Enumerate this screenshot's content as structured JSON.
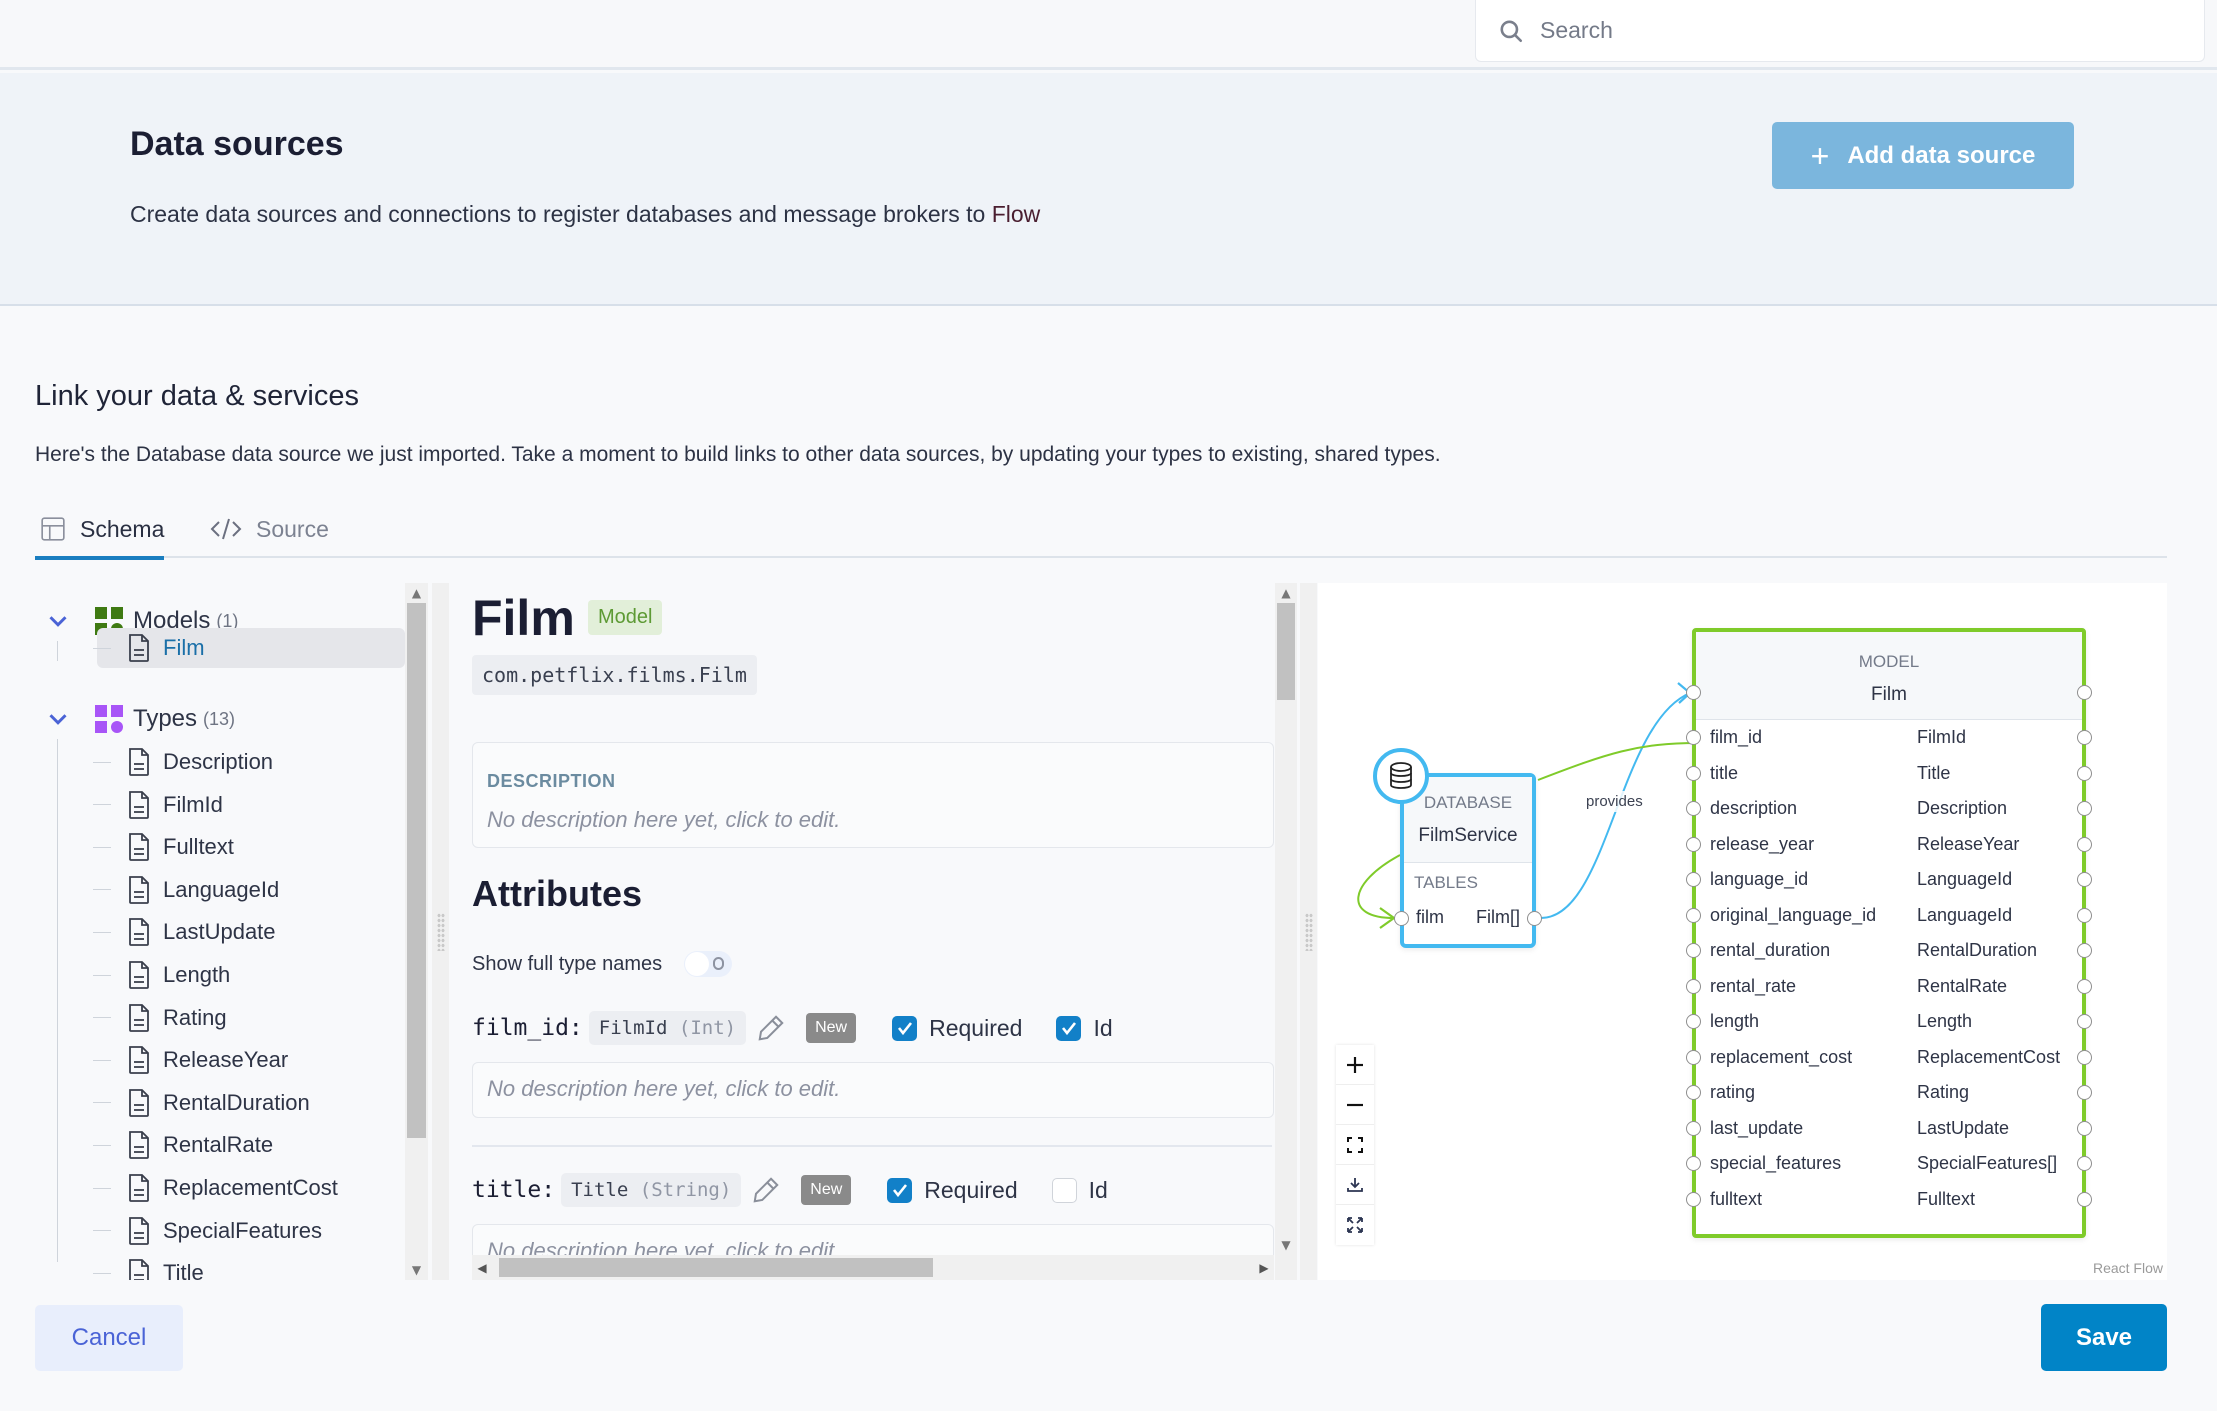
{
  "search": {
    "placeholder": "Search"
  },
  "header": {
    "title": "Data sources",
    "subtitle_prefix": "Create data sources and connections to register databases and message brokers to ",
    "subtitle_brand": "Flow",
    "add_button_label": "Add data source"
  },
  "section": {
    "title": "Link your data & services",
    "description": "Here's the Database data source we just imported. Take a moment to build links to other data sources, by updating your types to existing, shared types."
  },
  "tabs": [
    {
      "label": "Schema",
      "icon": "table-icon",
      "active": true
    },
    {
      "label": "Source",
      "icon": "code-icon",
      "active": false
    }
  ],
  "tree": {
    "models": {
      "label": "Models",
      "count": "(1)",
      "color": "#3f7a12",
      "items": [
        "Film"
      ]
    },
    "types": {
      "label": "Types",
      "count": "(13)",
      "color": "#a855f7",
      "items": [
        "Description",
        "FilmId",
        "Fulltext",
        "LanguageId",
        "LastUpdate",
        "Length",
        "Rating",
        "ReleaseYear",
        "RentalDuration",
        "RentalRate",
        "ReplacementCost",
        "SpecialFeatures",
        "Title"
      ]
    },
    "selected": "Film"
  },
  "detail": {
    "name": "Film",
    "badge": "Model",
    "fqn": "com.petflix.films.Film",
    "description_label": "DESCRIPTION",
    "description_placeholder": "No description here yet, click to edit.",
    "attributes_title": "Attributes",
    "show_full_type_names_label": "Show full type names",
    "show_full_type_names": false,
    "attributes": [
      {
        "name": "film_id:",
        "type": "FilmId",
        "primitive": "(Int)",
        "badge": "New",
        "required_label": "Required",
        "required": true,
        "id_label": "Id",
        "id": true,
        "description": "No description here yet, click to edit."
      },
      {
        "name": "title:",
        "type": "Title",
        "primitive": "(String)",
        "badge": "New",
        "required_label": "Required",
        "required": true,
        "id_label": "Id",
        "id": false,
        "description": "No description here yet, click to edit."
      }
    ]
  },
  "diagram": {
    "database_node": {
      "kind": "DATABASE",
      "name": "FilmService",
      "section": "TABLES",
      "table": "film",
      "table_type": "Film[]"
    },
    "edge_label": "provides",
    "model_node": {
      "kind": "MODEL",
      "name": "Film",
      "fields": [
        {
          "name": "film_id",
          "type": "FilmId"
        },
        {
          "name": "title",
          "type": "Title"
        },
        {
          "name": "description",
          "type": "Description"
        },
        {
          "name": "release_year",
          "type": "ReleaseYear"
        },
        {
          "name": "language_id",
          "type": "LanguageId"
        },
        {
          "name": "original_language_id",
          "type": "LanguageId"
        },
        {
          "name": "rental_duration",
          "type": "RentalDuration"
        },
        {
          "name": "rental_rate",
          "type": "RentalRate"
        },
        {
          "name": "length",
          "type": "Length"
        },
        {
          "name": "replacement_cost",
          "type": "ReplacementCost"
        },
        {
          "name": "rating",
          "type": "Rating"
        },
        {
          "name": "last_update",
          "type": "LastUpdate"
        },
        {
          "name": "special_features",
          "type": "SpecialFeatures[]"
        },
        {
          "name": "fulltext",
          "type": "Fulltext"
        }
      ]
    },
    "controls": [
      "zoom-in",
      "zoom-out",
      "fit-view",
      "download",
      "fullscreen"
    ],
    "attribution": "React Flow",
    "colors": {
      "database": "#43b9f0",
      "model": "#7fcb2a"
    }
  },
  "footer": {
    "cancel_label": "Cancel",
    "save_label": "Save"
  }
}
